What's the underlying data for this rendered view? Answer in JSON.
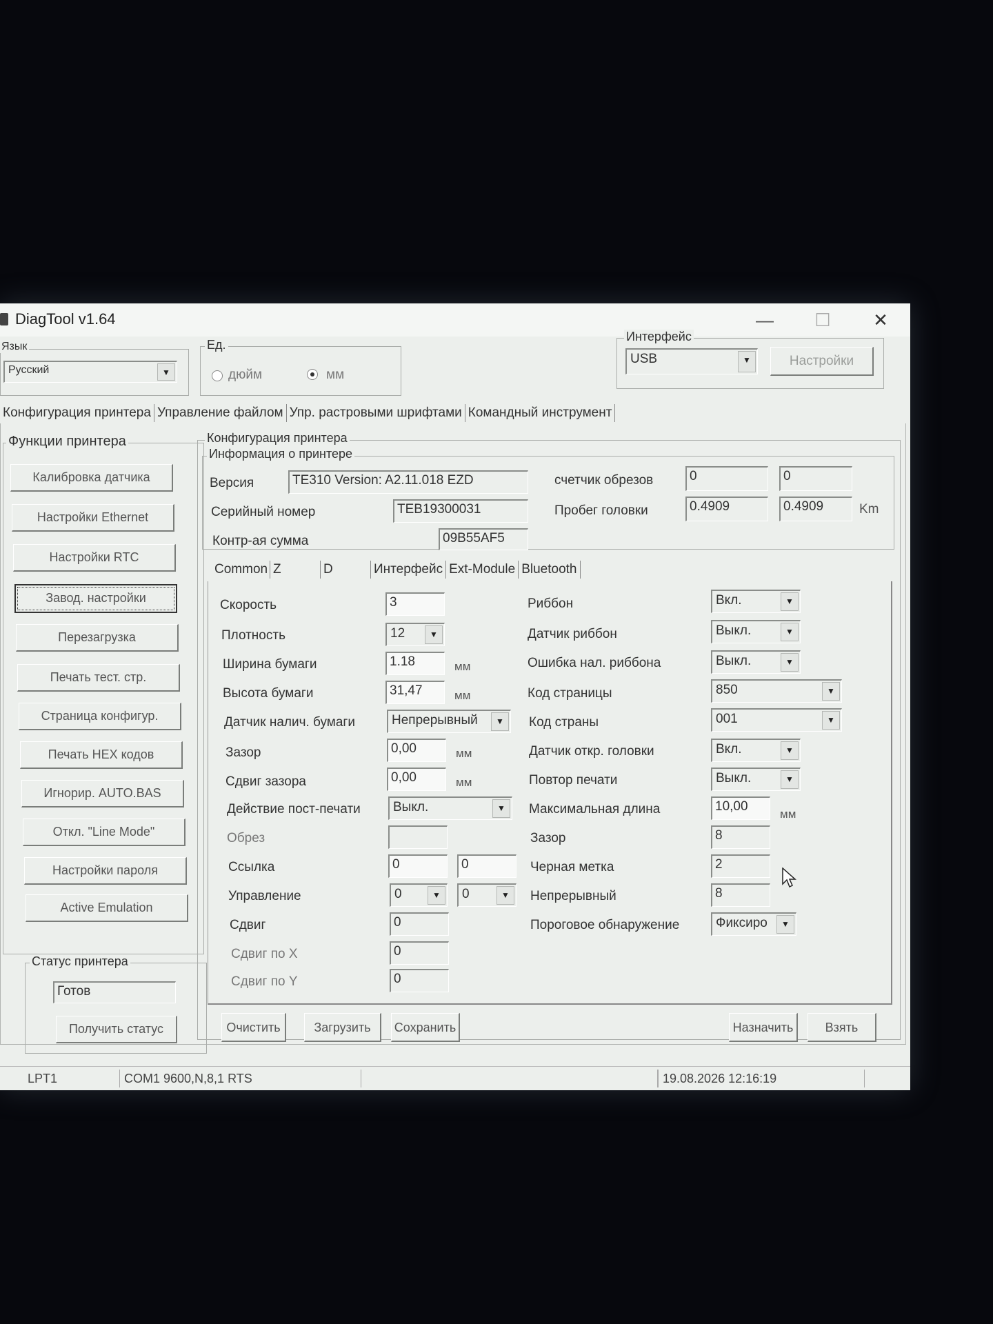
{
  "window": {
    "title": "DiagTool v1.64",
    "minimize": "—",
    "maximize": "☐",
    "close": "✕"
  },
  "language": {
    "label": "Язык",
    "value": "Русский"
  },
  "units": {
    "label": "Ед.",
    "inch": "дюйм",
    "mm": "мм",
    "selected": "мм"
  },
  "interface": {
    "label": "Интерфейс",
    "value": "USB",
    "settings_button": "Настройки"
  },
  "main_tabs": [
    "Конфигурация принтера",
    "Управление файлом",
    "Упр. растровыми шрифтами",
    "Командный инструмент"
  ],
  "functions": {
    "label": "Функции принтера",
    "buttons": [
      "Калибровка датчика",
      "Настройки Ethernet",
      "Настройки RTC",
      "Завод. настройки",
      "Перезагрузка",
      "Печать тест. стр.",
      "Страница конфигур.",
      "Печать HEX кодов",
      "Игнорир. AUTO.BAS",
      "Откл. \"Line Mode\"",
      "Настройки пароля",
      "Active Emulation"
    ]
  },
  "printer_status": {
    "label": "Статус принтера",
    "value": "Готов",
    "get_status_button": "Получить статус"
  },
  "config": {
    "label": "Конфигурация принтера",
    "info_label": "Информация о принтере",
    "version_label": "Версия",
    "version": "TE310 Version: A2.11.018 EZD",
    "serial_label": "Серийный номер",
    "serial": "TEB19300031",
    "checksum_label": "Контр-ая сумма",
    "checksum": "09B55AF5",
    "cut_counter_label": "счетчик обрезов",
    "cut_counter_1": "0",
    "cut_counter_2": "0",
    "head_mileage_label": "Пробег головки",
    "head_mileage_1": "0.4909",
    "head_mileage_2": "0.4909",
    "head_mileage_unit": "Km"
  },
  "sub_tabs": [
    "Common",
    "Z",
    "D",
    "Интерфейс",
    "Ext-Module",
    "Bluetooth"
  ],
  "left_params": {
    "speed_label": "Скорость",
    "speed": "3",
    "density_label": "Плотность",
    "density": "12",
    "paper_width_label": "Ширина бумаги",
    "paper_width": "1.18",
    "paper_width_unit": "мм",
    "paper_height_label": "Высота бумаги",
    "paper_height": "31,47",
    "paper_height_unit": "мм",
    "paper_sensor_label": "Датчик налич. бумаги",
    "paper_sensor": "Непрерывный",
    "gap_label": "Зазор",
    "gap": "0,00",
    "gap_unit": "мм",
    "gap_offset_label": "Сдвиг зазора",
    "gap_offset": "0,00",
    "gap_offset_unit": "мм",
    "post_print_label": "Действие пост-печати",
    "post_print": "Выкл.",
    "cut_label": "Обрез",
    "cut": "",
    "reference_label": "Ссылка",
    "reference_1": "0",
    "reference_2": "0",
    "control_label": "Управление",
    "control_1": "0",
    "control_2": "0",
    "shift_label": "Сдвиг",
    "shift": "0",
    "shift_x_label": "Сдвиг по X",
    "shift_x": "0",
    "shift_y_label": "Сдвиг по Y",
    "shift_y": "0"
  },
  "right_params": {
    "ribbon_label": "Риббон",
    "ribbon": "Вкл.",
    "ribbon_sensor_label": "Датчик риббон",
    "ribbon_sensor": "Выкл.",
    "ribbon_error_label": "Ошибка нал. риббона",
    "ribbon_error": "Выкл.",
    "codepage_label": "Код страницы",
    "codepage": "850",
    "country_label": "Код страны",
    "country": "001",
    "head_open_label": "Датчик откр. головки",
    "head_open": "Вкл.",
    "reprint_label": "Повтор печати",
    "reprint": "Выкл.",
    "max_length_label": "Максимальная длина",
    "max_length": "10,00",
    "max_length_unit": "мм",
    "gap2_label": "Зазор",
    "gap2": "8",
    "black_mark_label": "Черная метка",
    "black_mark": "2",
    "continuous_label": "Непрерывный",
    "continuous": "8",
    "threshold_label": "Пороговое обнаружение",
    "threshold": "Фиксиро"
  },
  "bottom_buttons": {
    "clear": "Очистить",
    "load": "Загрузить",
    "save": "Сохранить",
    "assign": "Назначить",
    "get": "Взять"
  },
  "statusbar": {
    "port": "LPT1",
    "com": "COM1 9600,N,8,1 RTS",
    "datetime": "19.08.2026 12:16:19"
  }
}
